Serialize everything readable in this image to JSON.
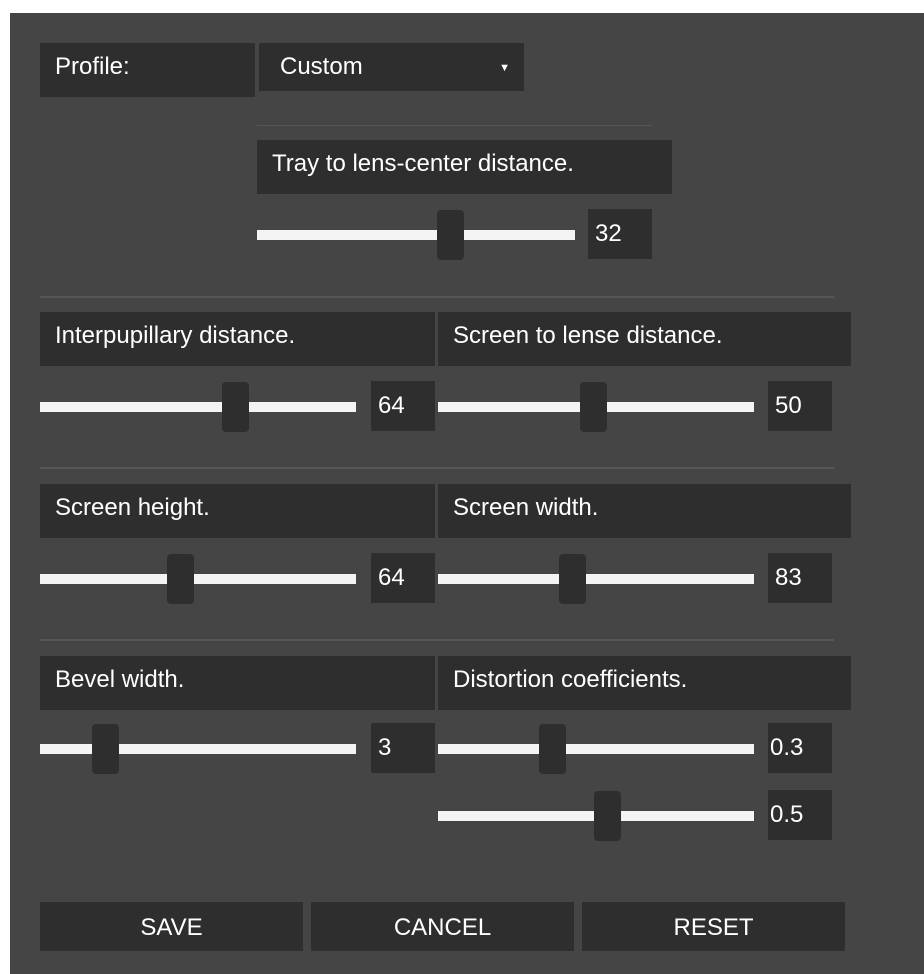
{
  "profile": {
    "label": "Profile:",
    "selected": "Custom"
  },
  "tray": {
    "label": "Tray to lens-center distance.",
    "value": "32",
    "fraction": 0.62
  },
  "ipd": {
    "label": "Interpupillary distance.",
    "value": "64",
    "fraction": 0.63
  },
  "screen_lens": {
    "label": "Screen to lense distance.",
    "value": "50",
    "fraction": 0.49
  },
  "screen_height": {
    "label": "Screen height.",
    "value": "64",
    "fraction": 0.44
  },
  "screen_width": {
    "label": "Screen width.",
    "value": "83",
    "fraction": 0.42
  },
  "bevel": {
    "label": "Bevel width.",
    "value": "3",
    "fraction": 0.18
  },
  "distortion": {
    "label": "Distortion coefficients.",
    "k1": {
      "value": "0.3",
      "fraction": 0.35
    },
    "k2": {
      "value": "0.5",
      "fraction": 0.54
    }
  },
  "buttons": {
    "save": "SAVE",
    "cancel": "CANCEL",
    "reset": "RESET"
  }
}
